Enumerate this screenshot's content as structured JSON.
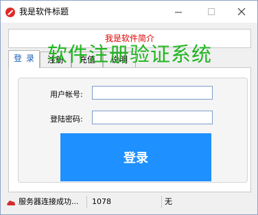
{
  "window": {
    "title": "我是软件标题",
    "minimize_glyph": "—",
    "maximize_glyph": "☐",
    "close_glyph": "✕"
  },
  "intro": {
    "text": "我是软件简介"
  },
  "tabs": [
    {
      "label": "登录"
    },
    {
      "label": "注册"
    },
    {
      "label": "充值"
    },
    {
      "label": "说明"
    }
  ],
  "tab_visible": {
    "t1": "注 册",
    "t2": "充 值",
    "t3": "说 明"
  },
  "form": {
    "account_label": "用户帐号:",
    "password_label": "登陆密码:",
    "account_value": "",
    "password_value": "",
    "login_label": "登录"
  },
  "overlay_text": "软件注册验证系统",
  "status": {
    "message": "服务器连接成功...",
    "code": "1078",
    "extra": "无"
  },
  "colors": {
    "accent_blue": "#1e90ff",
    "intro_red": "#e00000",
    "overlay_green": "#1fb51f",
    "tab_active_text": "#1d5fb8"
  },
  "icons": {
    "app": "red-app-icon",
    "status": "red-cloud-icon"
  }
}
